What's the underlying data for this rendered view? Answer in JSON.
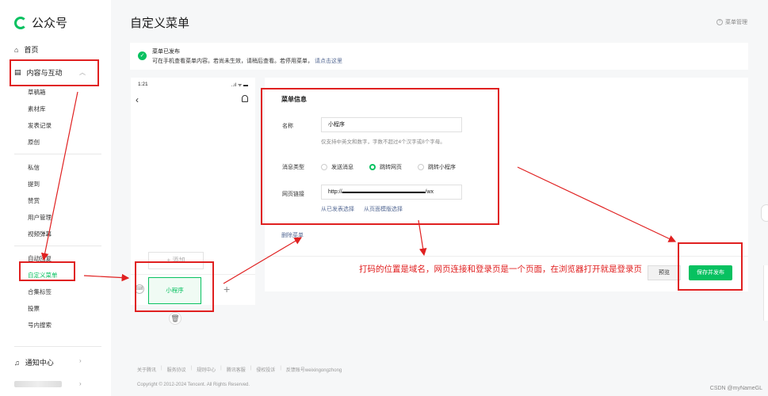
{
  "app": {
    "name": "公众号"
  },
  "sidebar": {
    "home": "首页",
    "content_section": "内容与互动",
    "content_items": [
      "草稿箱",
      "素材库",
      "发表记录",
      "原创"
    ],
    "interact_items": [
      "私信",
      "提到",
      "赞赏",
      "用户管理",
      "视频弹幕"
    ],
    "menu_items": [
      "自动回复",
      "自定义菜单",
      "合集标签",
      "投票",
      "号内搜索"
    ],
    "notifications": "通知中心"
  },
  "header": {
    "title": "自定义菜单",
    "menu_mgmt": "菜单管理"
  },
  "notice": {
    "title": "菜单已发布",
    "desc": "可在手机查看菜单内容。若尚未生效，请稍后查看。若停用菜单，",
    "link": "请点击这里"
  },
  "phone": {
    "time": "1:21",
    "status": "..ıl ᯤ ▬",
    "add_label": "+ 添加",
    "menu_item": "小程序",
    "plus": "+"
  },
  "form": {
    "title": "菜单信息",
    "name_label": "名称",
    "name_value": "小程序",
    "name_hint": "仅支持中英文和数字，字数不超过4个汉字或8个字母。",
    "type_label": "消息类型",
    "type_options": [
      "发送消息",
      "跳转网页",
      "跳转小程序"
    ],
    "type_selected": "跳转网页",
    "url_label": "网页链接",
    "url_value": "http://▬▬▬▬▬▬▬▬▬▬▬▬▬▬▬/wx",
    "url_link_published": "从已发表选择",
    "url_link_template": "从页面模版选择",
    "delete": "删除菜单",
    "preview": "预览",
    "save": "保存并发布"
  },
  "annotation": {
    "text": "打码的位置是域名，网页连接和登录页是一个页面，在浏览器打开就是登录页",
    "color": "#e02020"
  },
  "footer": {
    "links": [
      "关于腾讯",
      "服务协议",
      "规则中心",
      "腾讯客服",
      "侵权投诉",
      "反馈账号weixingongzhong"
    ],
    "copyright": "Copyright © 2012-2024 Tencent. All Rights Reserved."
  },
  "watermark": "CSDN @myNameGL",
  "colors": {
    "accent": "#07c160",
    "link": "#576b95",
    "annotation": "#e02020"
  }
}
